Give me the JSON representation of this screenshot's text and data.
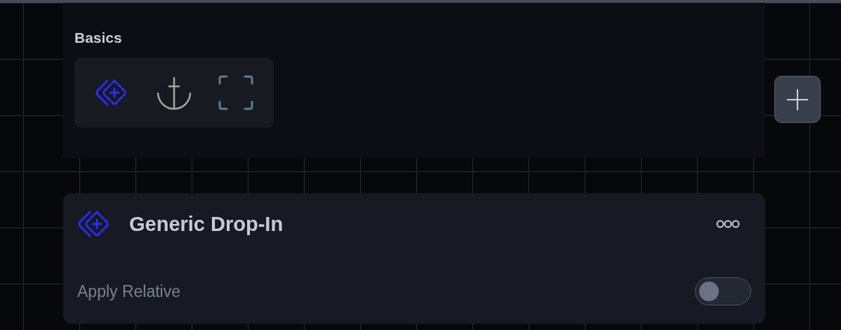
{
  "palette": {
    "title": "Basics",
    "tools": [
      {
        "kind": "drop-in"
      },
      {
        "kind": "anchor"
      },
      {
        "kind": "frame"
      }
    ]
  },
  "card": {
    "title": "Generic Drop-In",
    "setting": {
      "label": "Apply Relative",
      "on": false
    }
  }
}
